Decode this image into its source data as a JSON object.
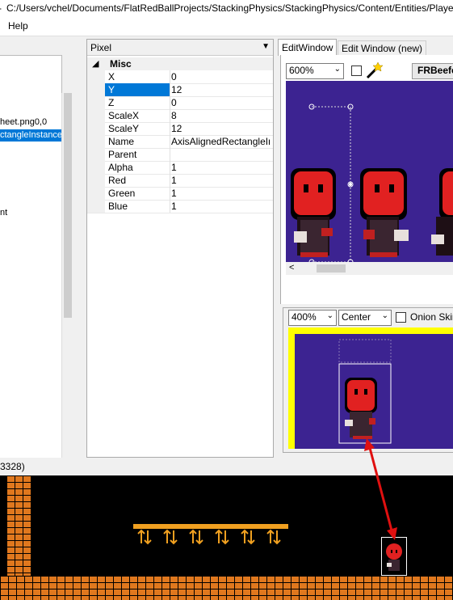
{
  "window": {
    "title_prefix": "-",
    "title": "C:/Users/vchel/Documents/FlatRedBallProjects/StackingPhysics/StackingPhysics/Content/Entities/Player/"
  },
  "menu": {
    "help": "Help"
  },
  "tree": {
    "items": [
      {
        "label": "heet.png0,0",
        "selected": false
      },
      {
        "label": "ctangleInstance",
        "selected": true
      },
      {
        "label": "nt",
        "selected": false
      }
    ]
  },
  "properties": {
    "header": "Pixel",
    "category": {
      "toggle": "◢",
      "label": "Misc"
    },
    "rows": [
      {
        "key": "X",
        "value": "0",
        "selected": false
      },
      {
        "key": "Y",
        "value": "12",
        "selected": true
      },
      {
        "key": "Z",
        "value": "0",
        "selected": false
      },
      {
        "key": "ScaleX",
        "value": "8",
        "selected": false
      },
      {
        "key": "ScaleY",
        "value": "12",
        "selected": false
      },
      {
        "key": "Name",
        "value": "AxisAlignedRectangleInsta",
        "selected": false
      },
      {
        "key": "Parent",
        "value": "",
        "selected": false
      },
      {
        "key": "Alpha",
        "value": "1",
        "selected": false
      },
      {
        "key": "Red",
        "value": "1",
        "selected": false
      },
      {
        "key": "Green",
        "value": "1",
        "selected": false
      },
      {
        "key": "Blue",
        "value": "1",
        "selected": false
      }
    ]
  },
  "tabs": [
    {
      "label": "EditWindow",
      "active": true
    },
    {
      "label": "Edit Window (new)",
      "active": false
    }
  ],
  "edit_toolbar": {
    "zoom": "600%",
    "texture_button": "FRBeefca"
  },
  "anim_toolbar": {
    "zoom": "400%",
    "alignment": "Center",
    "onion_skin": "Onion Skin"
  },
  "status": {
    "text": "3328)"
  },
  "colors": {
    "canvas_bg": "#3c2391",
    "anim_border": "#ffff00",
    "selection": "#0078d7",
    "arrow": "#e01010",
    "brick": "#e0781e"
  }
}
